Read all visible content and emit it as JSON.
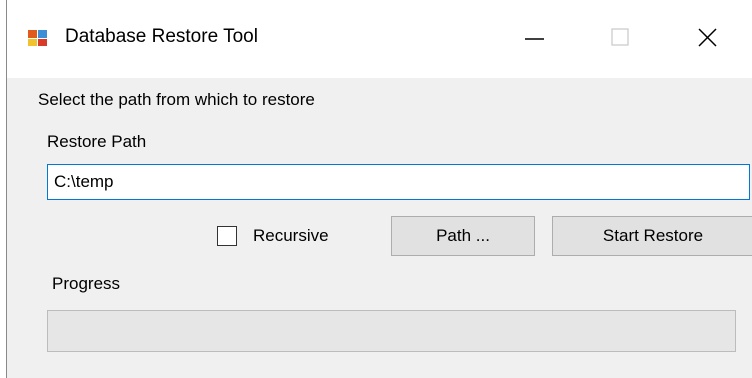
{
  "window": {
    "title": "Database Restore Tool",
    "app_icon": "database-form-icon",
    "controls": {
      "minimize_icon": "minimize-icon",
      "maximize_icon": "maximize-icon",
      "close_icon": "close-icon"
    }
  },
  "main": {
    "instruction": "Select the path from which to restore",
    "restore_path_label": "Restore Path",
    "restore_path_value": "C:\\temp",
    "recursive_label": "Recursive",
    "recursive_checked": false,
    "path_button_label": "Path ...",
    "start_restore_button_label": "Start Restore",
    "progress_label": "Progress",
    "progress_value": 0
  },
  "colors": {
    "input_focus_border": "#0078d7",
    "window_background": "#f0f0f0",
    "button_background": "#e1e1e1"
  }
}
